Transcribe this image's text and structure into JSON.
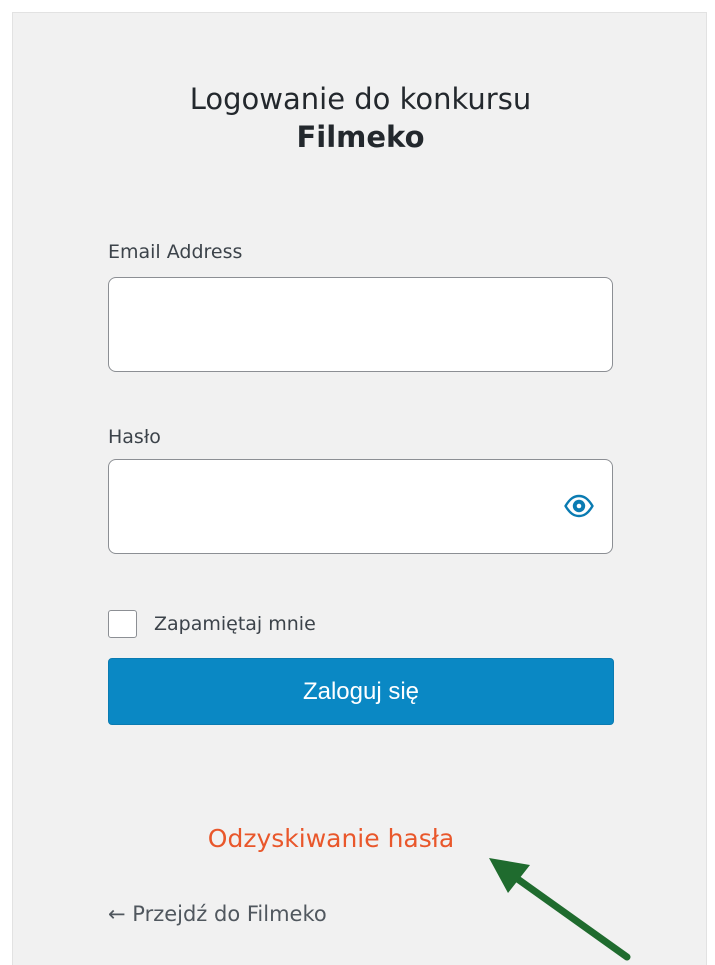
{
  "login": {
    "title_line1": "Logowanie do konkursu",
    "title_line2": "Filmeko",
    "email_label": "Email Address",
    "email_value": "",
    "password_label": "Hasło",
    "password_value": "",
    "remember_label": "Zapamiętaj mnie",
    "remember_checked": false,
    "submit_label": "Zaloguj się",
    "recover_link": "Odzyskiwanie hasła",
    "back_link": "← Przejdź do Filmeko"
  },
  "icons": {
    "password_toggle": "eye-icon",
    "checkbox": "checkbox-unchecked",
    "annotation_arrow": "arrow-up-left"
  },
  "colors": {
    "background": "#f1f1f1",
    "button": "#0a88c4",
    "button_text": "#ffffff",
    "eye_icon": "#0a7bb2",
    "recover_link": "#e9572b",
    "annotation_arrow": "#1f6b2e"
  }
}
